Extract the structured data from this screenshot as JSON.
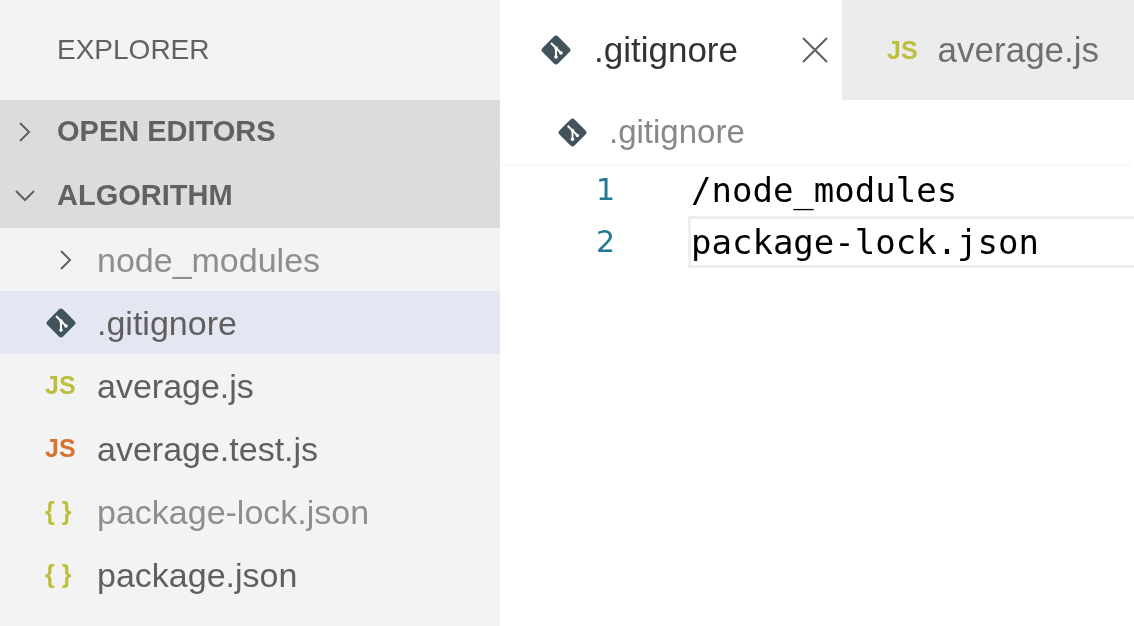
{
  "sidebar": {
    "title": "EXPLORER",
    "sections": [
      {
        "label": "OPEN EDITORS",
        "expanded": false
      },
      {
        "label": "ALGORITHM",
        "expanded": true,
        "items": [
          {
            "name": "node_modules",
            "kind": "folder",
            "expanded": false,
            "dimmed": true,
            "selected": false
          },
          {
            "name": ".gitignore",
            "kind": "git",
            "dimmed": false,
            "selected": true
          },
          {
            "name": "average.js",
            "kind": "glyph",
            "glyph": "JS",
            "color": "#bcbf3b",
            "dimmed": false,
            "selected": false
          },
          {
            "name": "average.test.js",
            "kind": "glyph",
            "glyph": "JS",
            "color": "#d8722f",
            "dimmed": false,
            "selected": false
          },
          {
            "name": "package-lock.json",
            "kind": "glyph",
            "glyph": "{ }",
            "color": "#bcbf3b",
            "dimmed": true,
            "selected": false
          },
          {
            "name": "package.json",
            "kind": "glyph",
            "glyph": "{ }",
            "color": "#bcbf3b",
            "dimmed": false,
            "selected": false
          }
        ]
      }
    ]
  },
  "tabs": [
    {
      "label": ".gitignore",
      "kind": "git",
      "selected": true
    },
    {
      "label": "average.js",
      "kind": "glyph",
      "glyph": "JS",
      "color": "#bcbf3b",
      "selected": false
    }
  ],
  "editor": {
    "breadcrumb": {
      "label": ".gitignore",
      "kind": "git"
    },
    "lines": [
      {
        "number": "1",
        "text": "/node_modules",
        "current": false
      },
      {
        "number": "2",
        "text": "package-lock.json",
        "current": true
      }
    ]
  }
}
